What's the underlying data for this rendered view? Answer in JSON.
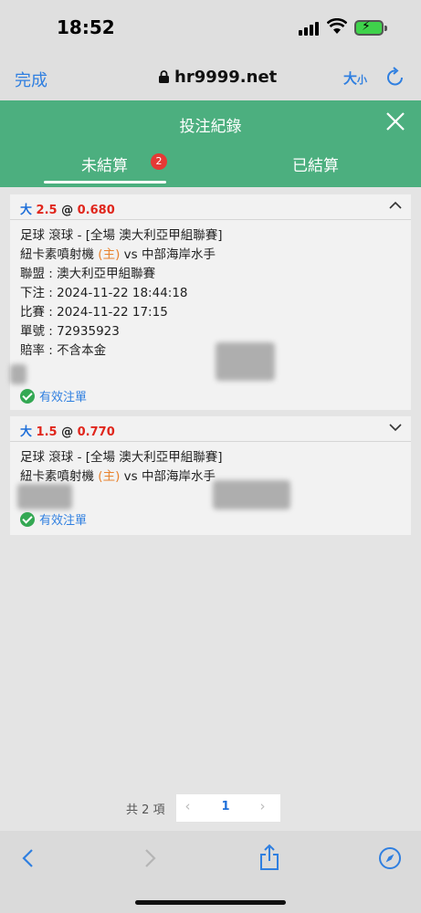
{
  "status": {
    "time": "18:52"
  },
  "browser": {
    "done": "完成",
    "url": "hr9999.net",
    "textsize_big": "大",
    "textsize_small": "小"
  },
  "header": {
    "title": "投注紀錄",
    "tabs": [
      {
        "label": "未結算",
        "badge": "2"
      },
      {
        "label": "已結算"
      }
    ]
  },
  "bets": [
    {
      "type": "大",
      "handicap": "2.5",
      "at": "@",
      "odds": "0.680",
      "league_line": "足球 滾球 - [全場 澳大利亞甲組聯賽]",
      "home": "紐卡素噴射機",
      "home_tag": "(主)",
      "vs": "vs",
      "away": "中部海岸水手",
      "league": "聯盟 : 澳大利亞甲組聯賽",
      "bet_time": "下注 : 2024-11-22 18:44:18",
      "match_time": "比賽 : 2024-11-22 17:15",
      "ticket": "單號 : 72935923",
      "odds_note": "賠率 : 不含本金",
      "status": "有效注單"
    },
    {
      "type": "大",
      "handicap": "1.5",
      "at": "@",
      "odds": "0.770",
      "league_line": "足球 滾球 - [全場 澳大利亞甲組聯賽]",
      "home": "紐卡素噴射機",
      "home_tag": "(主)",
      "vs": "vs",
      "away": "中部海岸水手",
      "status": "有效注單"
    }
  ],
  "pager": {
    "total": "共 2 項",
    "prev": "‹",
    "page": "1",
    "next": "›"
  },
  "colors": {
    "header_green": "#4caf7f",
    "accent_blue": "#2f7fe0",
    "odds_red": "#e0261c"
  }
}
